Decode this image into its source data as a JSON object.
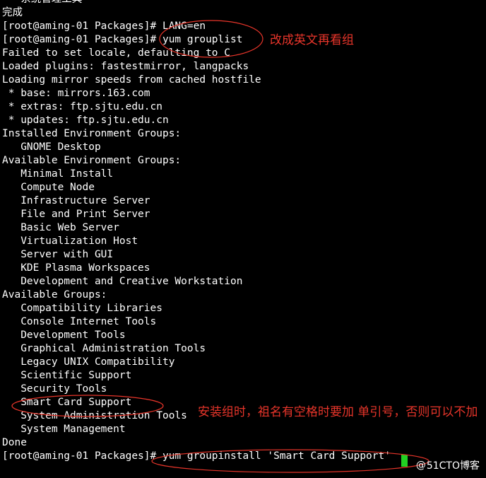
{
  "terminal": {
    "lines": [
      "   系统管理工具",
      "完成",
      "[root@aming-01 Packages]# LANG=en",
      "[root@aming-01 Packages]# yum grouplist",
      "Failed to set locale, defaulting to C",
      "Loaded plugins: fastestmirror, langpacks",
      "Loading mirror speeds from cached hostfile",
      " * base: mirrors.163.com",
      " * extras: ftp.sjtu.edu.cn",
      " * updates: ftp.sjtu.edu.cn",
      "Installed Environment Groups:",
      "   GNOME Desktop",
      "Available Environment Groups:",
      "   Minimal Install",
      "   Compute Node",
      "   Infrastructure Server",
      "   File and Print Server",
      "   Basic Web Server",
      "   Virtualization Host",
      "   Server with GUI",
      "   KDE Plasma Workspaces",
      "   Development and Creative Workstation",
      "Available Groups:",
      "   Compatibility Libraries",
      "   Console Internet Tools",
      "   Development Tools",
      "   Graphical Administration Tools",
      "   Legacy UNIX Compatibility",
      "   Scientific Support",
      "   Security Tools",
      "   Smart Card Support",
      "   System Administration Tools",
      "   System Management",
      "Done",
      "[root@aming-01 Packages]# yum groupinstall 'Smart Card Support'"
    ]
  },
  "annotations": {
    "note_1": "改成英文再看组",
    "note_2": "安装组时，祖名有空格时要加 单引号，否则可以不加"
  },
  "watermark": {
    "prefix": "@",
    "text": "51CTO博客"
  },
  "colors": {
    "annotation": "#e8352a",
    "cursor": "#22d022",
    "terminal_bg": "#000000",
    "terminal_fg": "#ffffff"
  }
}
